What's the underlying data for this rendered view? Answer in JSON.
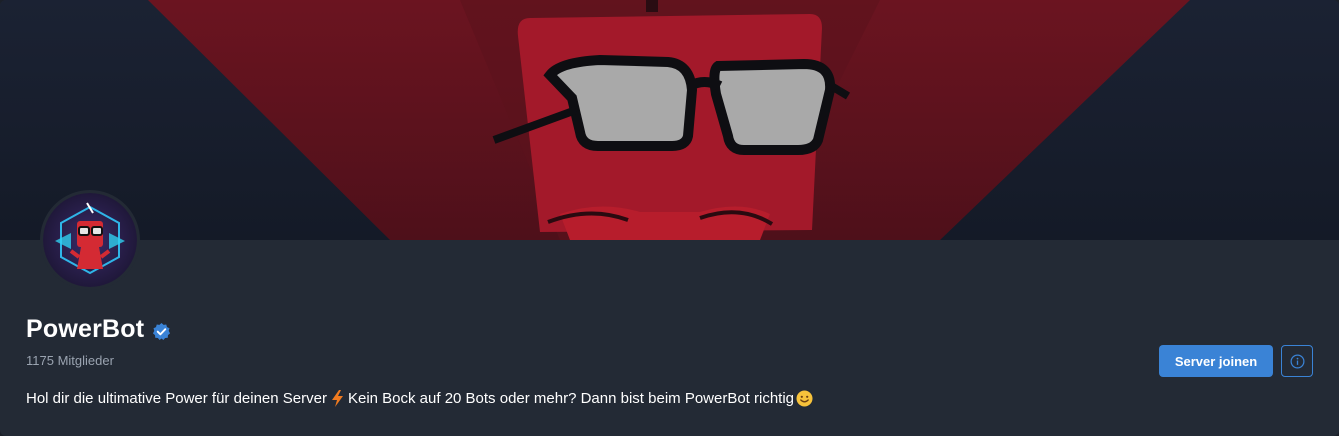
{
  "server": {
    "name": "PowerBot",
    "verified": true,
    "members": "1175 Mitglieder",
    "description_part1": "Hol dir die ultimative Power für deinen Server",
    "description_part2": "Kein Bock auf 20 Bots oder mehr? Dann bist beim PowerBot richtig"
  },
  "actions": {
    "join_label": "Server joinen",
    "info_icon": "info-icon"
  },
  "icons": {
    "verified": "verified-badge-icon",
    "bolt": "lightning-bolt-emoji",
    "smile": "smiling-face-emoji"
  },
  "colors": {
    "accent": "#3a83d6",
    "card_bg": "#232a35",
    "banner_red": "#8c1a24",
    "mascot_red": "#c4232e"
  }
}
